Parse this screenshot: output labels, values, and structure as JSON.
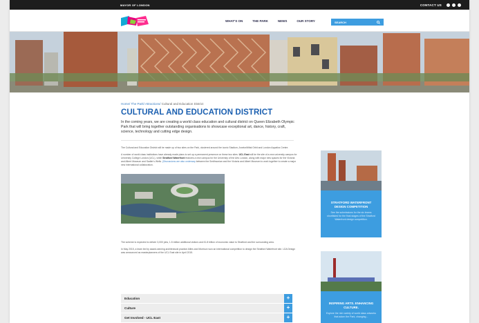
{
  "topbar": {
    "left_label": "MAYOR OF LONDON",
    "contact_label": "CONTACT US"
  },
  "header": {
    "logo_alt": "Queen Elizabeth Olympic Park",
    "nav": [
      "WHAT'S ON",
      "THE PARK",
      "NEWS",
      "OUR STORY"
    ],
    "search_placeholder": "SEARCH"
  },
  "breadcrumb": {
    "items": [
      "Home",
      "The Park",
      "Attractions"
    ],
    "current": "Cultural and Education District"
  },
  "page_title": "CULTURAL AND EDUCATION DISTRICT",
  "intro": "In the coming years, we are creating a world class education and cultural district on Queen Elizabeth Olympic Park that will bring together outstanding organisations to showcase exceptional art, dance, history, craft, science, technology and cutting edge design.",
  "body": {
    "p1": "The Cultural and Education District will be made up of two sites on the Park, clustered around the iconic Stadium, ArcelorMittal Orbit and London Aquatics Centre.",
    "p2_a": "A number of world class institutions have already made plans to set up a permanent presence on these two sites. ",
    "p2_ucl": "UCL East",
    "p2_b": " will be the site of a new university campus for University College London (UCL), while ",
    "p2_sw": "Stratford Waterfront",
    "p2_c": " features a new campus for the University of the Arts London, along with major new spaces for the Victoria and Albert Museum and Sadler's Wells. ",
    "p2_link": "(Discussions are also underway",
    "p2_d": " between the Smithsonian and the Victoria and Albert Museum to work together to create a major new international collaboration.",
    "p3": "The scheme is expected to deliver 3,000 jobs, 1.5 million additional visitors and £1.8 billion of economic value to Stratford and the surrounding area.",
    "p4": "In May 2015, a team led by award-winning architectural practice Allies and Morrison won an international competition to design the Stratford Waterfront site. LDA Design was announced as masterplanners of the UCL East site in April 2015."
  },
  "accordion": [
    "Education",
    "Culture",
    "Get Involved - UCL East"
  ],
  "cards": [
    {
      "title": "STRATFORD WATERFRONT DESIGN COMPETITION",
      "text": "See the submissions for the six teams shortlisted for the final stages of the Stratford Waterfront design competition."
    },
    {
      "title": "INSPIRING ARTS. ENHANCING CULTURE.",
      "text": "Explore the rich variety of world class artworks that adorn the Park, changing..."
    }
  ],
  "colors": {
    "accent": "#3d9de0",
    "title": "#1a5fb0",
    "topbar": "#1d1d1d"
  }
}
